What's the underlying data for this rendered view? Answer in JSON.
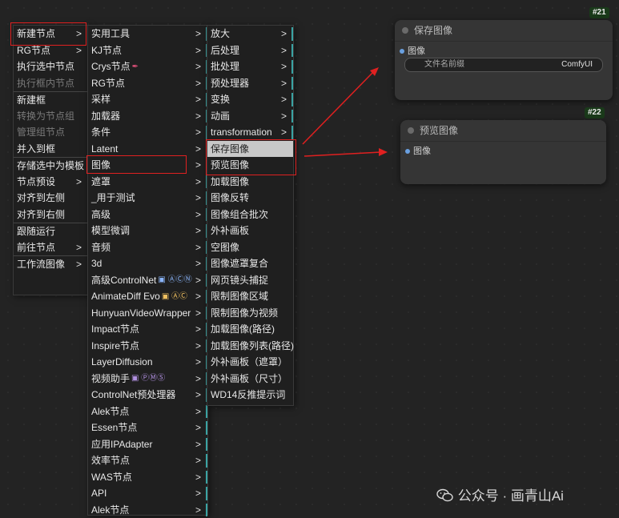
{
  "menu1": {
    "items": [
      {
        "label": "新建节点",
        "arrow": true
      },
      {
        "label": "RG节点",
        "arrow": true
      },
      {
        "label": "执行选中节点"
      },
      {
        "label": "执行框内节点",
        "disabled": true
      },
      {
        "label": "新建框",
        "sep": true
      },
      {
        "label": "转换为节点组",
        "disabled": true
      },
      {
        "label": "管理组节点",
        "disabled": true
      },
      {
        "label": "并入到框"
      },
      {
        "label": "存储选中为模板",
        "sep": true
      },
      {
        "label": "节点预设",
        "arrow": true
      },
      {
        "label": "对齐到左侧"
      },
      {
        "label": "对齐到右侧"
      },
      {
        "label": "跟随运行",
        "sep": true
      },
      {
        "label": "前往节点",
        "arrow": true
      },
      {
        "label": "工作流图像",
        "arrow": true,
        "sep": true
      }
    ]
  },
  "menu2": {
    "items": [
      {
        "label": "实用工具"
      },
      {
        "label": "KJ节点"
      },
      {
        "label": "Crys节点"
      },
      {
        "label": "RG节点"
      },
      {
        "label": "采样"
      },
      {
        "label": "加载器"
      },
      {
        "label": "条件"
      },
      {
        "label": "Latent"
      },
      {
        "label": "图像"
      },
      {
        "label": "遮罩"
      },
      {
        "label": "_用于测试"
      },
      {
        "label": "高级"
      },
      {
        "label": "模型微调"
      },
      {
        "label": "音频"
      },
      {
        "label": "3d"
      },
      {
        "label": "高级ControlNet"
      },
      {
        "label": "AnimateDiff Evo"
      },
      {
        "label": "HunyuanVideoWrapper"
      },
      {
        "label": "Impact节点"
      },
      {
        "label": "Inspire节点"
      },
      {
        "label": "LayerDiffusion"
      },
      {
        "label": "视频助手"
      },
      {
        "label": "ControlNet预处理器"
      },
      {
        "label": "Alek节点"
      },
      {
        "label": "Essen节点"
      },
      {
        "label": "应用IPAdapter"
      },
      {
        "label": "效率节点"
      },
      {
        "label": "WAS节点"
      },
      {
        "label": "API"
      },
      {
        "label": "Alek节点"
      }
    ]
  },
  "menu3": {
    "items": [
      {
        "label": "放大",
        "arrow": true
      },
      {
        "label": "后处理",
        "arrow": true
      },
      {
        "label": "批处理",
        "arrow": true
      },
      {
        "label": "预处理器",
        "arrow": true
      },
      {
        "label": "变换",
        "arrow": true
      },
      {
        "label": "动画",
        "arrow": true
      },
      {
        "label": "transformation",
        "arrow": true
      },
      {
        "label": "保存图像",
        "highlight": true
      },
      {
        "label": "预览图像"
      },
      {
        "label": "加载图像"
      },
      {
        "label": "图像反转"
      },
      {
        "label": "图像组合批次"
      },
      {
        "label": "外补画板"
      },
      {
        "label": "空图像"
      },
      {
        "label": "图像遮罩复合"
      },
      {
        "label": "网页镜头捕捉"
      },
      {
        "label": "限制图像区域"
      },
      {
        "label": "限制图像为视频"
      },
      {
        "label": "加载图像(路径)"
      },
      {
        "label": "加载图像列表(路径)"
      },
      {
        "label": "外补画板（遮罩）"
      },
      {
        "label": "外补画板（尺寸）"
      },
      {
        "label": "WD14反推提示词"
      }
    ]
  },
  "node21": {
    "badge": "#21",
    "title": "保存图像",
    "port": "图像",
    "widget_label": "文件名前缀",
    "widget_value": "ComfyUI"
  },
  "node22": {
    "badge": "#22",
    "title": "预览图像",
    "port": "图像"
  },
  "watermark": {
    "text": "公众号 · 画青山Ai"
  },
  "colors": {
    "highlight": "#c8c8c8",
    "red": "#e02020",
    "teal": "#3aa3a3",
    "port": "#6aa0e0"
  }
}
